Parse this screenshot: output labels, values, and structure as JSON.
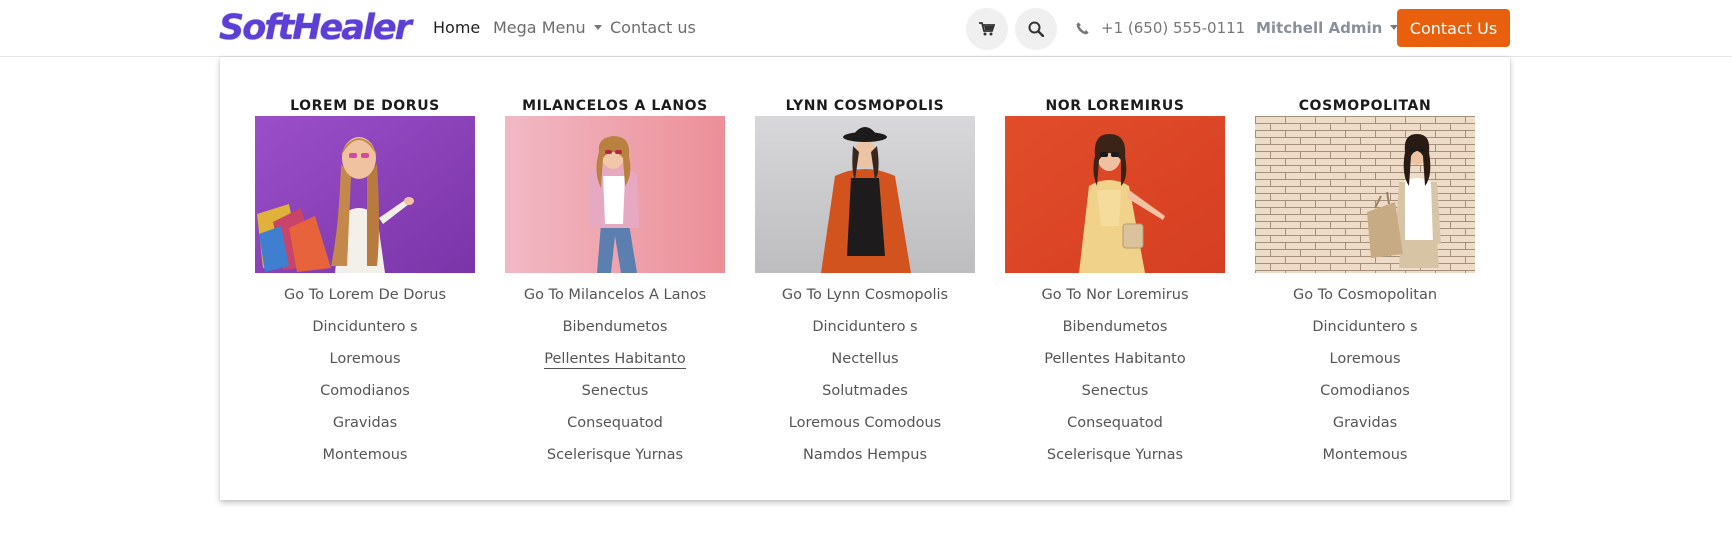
{
  "brand": {
    "logo_text": "SoftHealer",
    "accent": "#5b3fd6",
    "cta_color": "#e8600d"
  },
  "nav": {
    "items": [
      {
        "label": "Home",
        "active": true
      },
      {
        "label": "Mega Menu",
        "dropdown": true
      },
      {
        "label": "Contact us"
      }
    ]
  },
  "header": {
    "cart_icon": "shopping-cart-icon",
    "search_icon": "search-icon",
    "phone_icon": "phone-icon",
    "phone": "+1 (650) 555-0111",
    "user": "Mitchell Admin",
    "cta_label": "Contact Us"
  },
  "mega_menu": {
    "columns": [
      {
        "title": "LOREM DE DORUS",
        "links": [
          "Go To Lorem De Dorus",
          "Dinciduntero s",
          "Loremous",
          "Comodianos",
          "Gravidas",
          "Montemous"
        ]
      },
      {
        "title": "MILANCELOS A LANOS",
        "links": [
          "Go To Milancelos A Lanos",
          "Bibendumetos",
          "Pellentes Habitanto",
          "Senectus",
          "Consequatod",
          "Scelerisque Yurnas"
        ],
        "hovered_link": 2
      },
      {
        "title": "LYNN COSMOPOLIS",
        "links": [
          "Go To Lynn Cosmopolis",
          "Dinciduntero s",
          "Nectellus",
          "Solutmades",
          "Loremous Comodous",
          "Namdos Hempus"
        ]
      },
      {
        "title": "NOR LOREMIRUS",
        "links": [
          "Go To Nor Loremirus",
          "Bibendumetos",
          "Pellentes Habitanto",
          "Senectus",
          "Consequatod",
          "Scelerisque Yurnas"
        ]
      },
      {
        "title": "COSMOPOLITAN",
        "links": [
          "Go To Cosmopolitan",
          "Dinciduntero s",
          "Loremous",
          "Comodianos",
          "Gravidas",
          "Montemous"
        ]
      }
    ]
  }
}
